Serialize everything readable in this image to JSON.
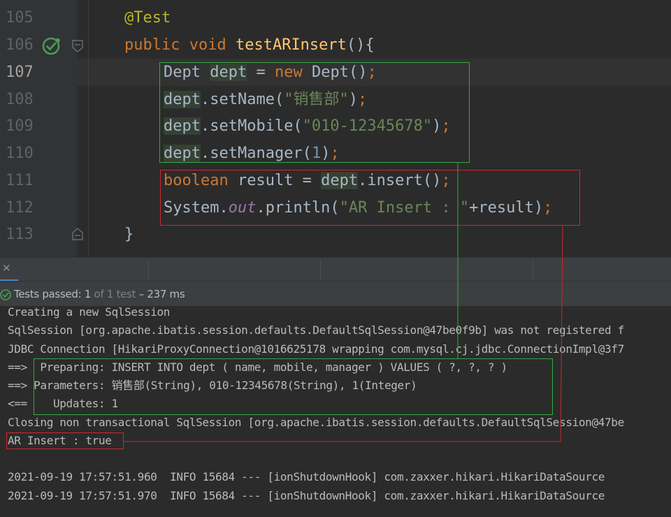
{
  "editor": {
    "line_numbers": [
      "105",
      "106",
      "107",
      "108",
      "109",
      "110",
      "111",
      "112",
      "113"
    ],
    "lines": {
      "l105": {
        "annotation": "@Test"
      },
      "l106": {
        "public": "public",
        "void": "void",
        "method": "testARInsert",
        "rest": "(){"
      },
      "l107": {
        "type": "Dept",
        "var": "dept",
        "eq": " = ",
        "new": "new",
        "ctor": " Dept()",
        "semi": ";"
      },
      "l108": {
        "obj": "dept",
        "call": ".setName(",
        "arg": "\"销售部\"",
        "close": ")",
        "semi": ";"
      },
      "l109": {
        "obj": "dept",
        "call": ".setMobile(",
        "arg": "\"010-12345678\"",
        "close": ")",
        "semi": ";"
      },
      "l110": {
        "obj": "dept",
        "call": ".setManager(",
        "arg": "1",
        "close": ")",
        "semi": ";"
      },
      "l111": {
        "type": "boolean",
        "pre": " result = ",
        "obj": "dept",
        "call": ".insert()",
        "semi": ";"
      },
      "l112": {
        "cls": "System.",
        "field": "out",
        "call": ".println(",
        "arg": "\"AR Insert : \"",
        "rest": "+result)",
        "semi": ";"
      },
      "l113": {
        "brace": "}"
      }
    },
    "icons": {
      "run": "run-passed-icon",
      "fold": "fold-marker-icon"
    }
  },
  "panel": {
    "tab": {
      "close_glyph": "×"
    }
  },
  "status": {
    "label": "Tests passed: ",
    "passed": "1",
    "of_text": " of 1 test",
    "duration": " – 237 ms",
    "icon": "check-circle-icon"
  },
  "console": {
    "lines": [
      "Creating a new SqlSession",
      "SqlSession [org.apache.ibatis.session.defaults.DefaultSqlSession@47be0f9b] was not registered f",
      "JDBC Connection [HikariProxyConnection@1016625178 wrapping com.mysql.cj.jdbc.ConnectionImpl@3f7",
      "==>  Preparing: INSERT INTO dept ( name, mobile, manager ) VALUES ( ?, ?, ? )",
      "==> Parameters: 销售部(String), 010-12345678(String), 1(Integer)",
      "<==    Updates: 1",
      "Closing non transactional SqlSession [org.apache.ibatis.session.defaults.DefaultSqlSession@47be",
      "AR Insert : true",
      "",
      "2021-09-19 17:57:51.960  INFO 15684 --- [ionShutdownHook] com.zaxxer.hikari.HikariDataSource",
      "2021-09-19 17:57:51.970  INFO 15684 --- [ionShutdownHook] com.zaxxer.hikari.HikariDataSource"
    ]
  },
  "colors": {
    "background": "#2b2b2b",
    "keyword": "#cc7832",
    "string": "#6a8759",
    "number": "#6897bb",
    "method": "#ffc66d",
    "annotation": "#bbb529",
    "highlight_green": "#35a845",
    "highlight_red": "#d0272b",
    "passed_green": "#499c54"
  }
}
